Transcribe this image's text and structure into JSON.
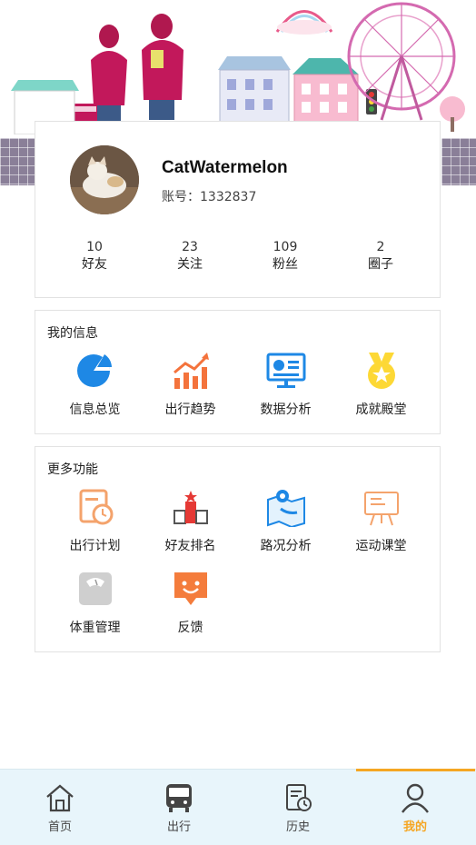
{
  "profile": {
    "username": "CatWatermelon",
    "account": "账号：1332837",
    "stats": [
      {
        "value": "10",
        "label": "好友"
      },
      {
        "value": "23",
        "label": "关注"
      },
      {
        "value": "109",
        "label": "粉丝"
      },
      {
        "value": "2",
        "label": "圈子"
      }
    ]
  },
  "my_info": {
    "title": "我的信息",
    "items": [
      {
        "label": "信息总览",
        "icon": "pie-chart-icon"
      },
      {
        "label": "出行趋势",
        "icon": "trend-chart-icon"
      },
      {
        "label": "数据分析",
        "icon": "monitor-chart-icon"
      },
      {
        "label": "成就殿堂",
        "icon": "medal-icon"
      }
    ]
  },
  "more_features": {
    "title": "更多功能",
    "items": [
      {
        "label": "出行计划",
        "icon": "plan-clock-icon"
      },
      {
        "label": "好友排名",
        "icon": "podium-icon"
      },
      {
        "label": "路况分析",
        "icon": "map-pin-icon"
      },
      {
        "label": "运动课堂",
        "icon": "whiteboard-icon"
      },
      {
        "label": "体重管理",
        "icon": "scale-icon"
      },
      {
        "label": "反馈",
        "icon": "chat-smile-icon"
      }
    ]
  },
  "tabbar": {
    "tabs": [
      {
        "label": "首页",
        "icon": "home-icon"
      },
      {
        "label": "出行",
        "icon": "bus-icon"
      },
      {
        "label": "历史",
        "icon": "history-icon"
      },
      {
        "label": "我的",
        "icon": "user-icon"
      }
    ],
    "active_color": "#f5a623"
  }
}
